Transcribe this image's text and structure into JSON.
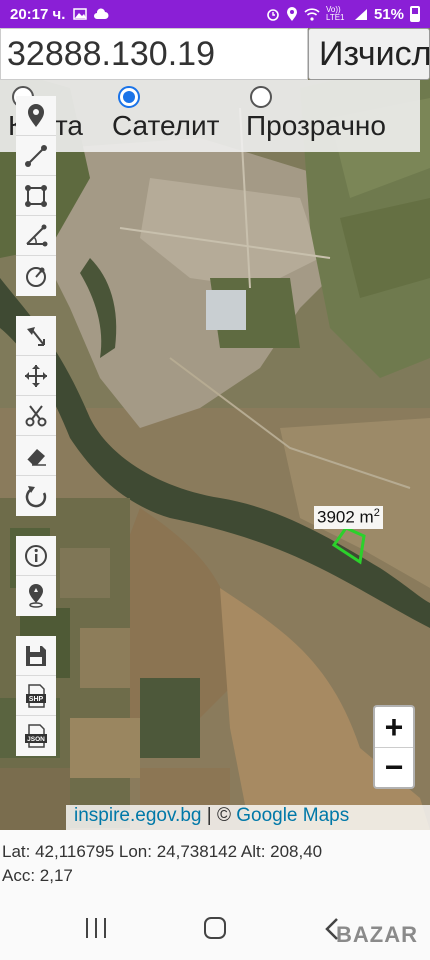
{
  "status_bar": {
    "time": "20:17 ч.",
    "icons_left": [
      "gallery-icon",
      "cloud-icon"
    ],
    "icons_right": [
      "alarm-icon",
      "location-icon",
      "wifi-icon",
      "volte-icon",
      "signal-icon"
    ],
    "volte_text": "Vo)) LTE1",
    "battery_percent": "51%"
  },
  "search": {
    "coordinate_value": "32888.130.19",
    "calculate_label": "Изчисли"
  },
  "map_type": {
    "options": [
      {
        "label": "Карта",
        "checked": false
      },
      {
        "label": "Сателит",
        "checked": true
      },
      {
        "label": "Прозрачно",
        "checked": false
      }
    ]
  },
  "toolbar": {
    "group1": [
      "marker-icon",
      "line-icon",
      "polygon-icon",
      "measure-angle-icon",
      "circle-icon"
    ],
    "group2": [
      "select-edit-icon",
      "move-icon",
      "cut-icon",
      "eraser-icon",
      "undo-icon"
    ],
    "group3": [
      "info-icon",
      "gps-location-icon"
    ],
    "group4": [
      "save-icon",
      "export-shp-icon",
      "export-json-icon"
    ],
    "shp_text": "SHP",
    "json_text": "JSON"
  },
  "map": {
    "area_value": "3902 m",
    "area_unit_sup": "2",
    "polygon_color": "#2bd12b"
  },
  "zoom": {
    "in": "+",
    "out": "−"
  },
  "attribution": {
    "source_link": "inspire.egov.bg",
    "separator": " | © ",
    "maps_link": "Google Maps"
  },
  "info": {
    "line1": "Lat: 42,116795 Lon: 24,738142 Alt: 208,40",
    "line2": "Acc: 2,17"
  },
  "nav_bar": {
    "watermark": "BAZAR"
  },
  "colors": {
    "status_bar": "#8a1fd6",
    "accent": "#1a73e8",
    "link": "#0078a8"
  }
}
